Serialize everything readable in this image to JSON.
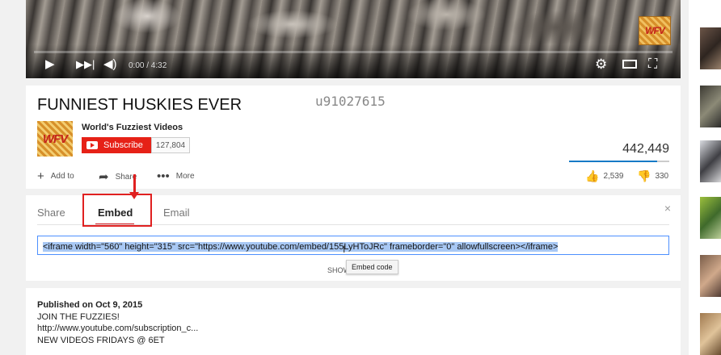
{
  "player": {
    "time": "0:00 / 4:32",
    "watermark": "WFV",
    "progress_fraction": 0.0
  },
  "video": {
    "title": "FUNNIEST HUSKIES EVER",
    "overlay_text": "u91027615",
    "channel_name": "World's Fuzziest Videos",
    "channel_logo_text": "WFV",
    "subscribe_label": "Subscribe",
    "subscriber_count": "127,804",
    "views": "442,449",
    "likes_fraction": 0.88,
    "actions": {
      "add_to": "Add to",
      "share": "Share",
      "more": "More"
    },
    "likes": "2,539",
    "dislikes": "330"
  },
  "share_panel": {
    "tabs": {
      "share": "Share",
      "embed": "Embed",
      "email": "Email"
    },
    "active_tab": "Embed",
    "embed_code": "<iframe width=\"560\" height=\"315\" src=\"https://www.youtube.com/embed/155LyHToJRc\" frameborder=\"0\" allowfullscreen></iframe>",
    "show_more": "SHOW",
    "tooltip": "Embed code",
    "close": "×"
  },
  "description": {
    "published": "Published on Oct 9, 2015",
    "lines": [
      "JOIN THE FUZZIES!",
      "http://www.youtube.com/subscription_c...",
      "NEW VIDEOS FRIDAYS @ 6ET"
    ]
  },
  "icons": {
    "play": "play-icon",
    "next": "next-icon",
    "volume": "volume-icon",
    "settings": "gear-icon",
    "theater": "theater-icon",
    "fullscreen": "fullscreen-icon",
    "add": "plus-icon",
    "share": "share-arrow-icon",
    "more": "ellipsis-icon",
    "like": "thumbs-up-icon",
    "dislike": "thumbs-down-icon",
    "close": "close-icon"
  },
  "colors": {
    "subscribe": "#e62117",
    "annotation": "#e02020",
    "link_blue": "#167ac6"
  }
}
